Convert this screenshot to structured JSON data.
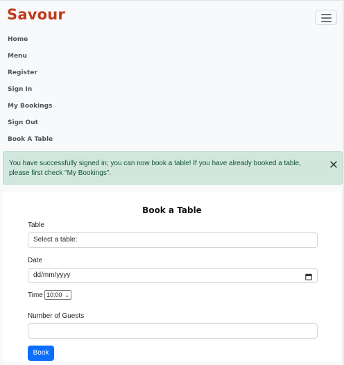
{
  "brand": {
    "name": "Savour",
    "color": "#c0391d"
  },
  "navbar": {
    "toggler_icon": "hamburger-icon",
    "links": [
      "Home",
      "Menu",
      "Register",
      "Sign In",
      "My Bookings",
      "Sign Out",
      "Book A Table"
    ]
  },
  "alert": {
    "message": "You have successfully signed in; you can now book a table! If you have already booked a table, please first check \"My Bookings\".",
    "close_icon": "close-icon",
    "background": "#d1e7dd",
    "text_color": "#0f5132"
  },
  "form": {
    "title": "Book a Table",
    "table_label": "Table",
    "table_placeholder": "Select a table:",
    "date_label": "Date",
    "date_placeholder": "dd/mm/yyyy",
    "date_icon": "calendar-icon",
    "time_label": "Time",
    "time_value": "10:00",
    "guests_label": "Number of Guests",
    "guests_value": "",
    "submit_label": "Book",
    "submit_color": "#0d6efd"
  }
}
